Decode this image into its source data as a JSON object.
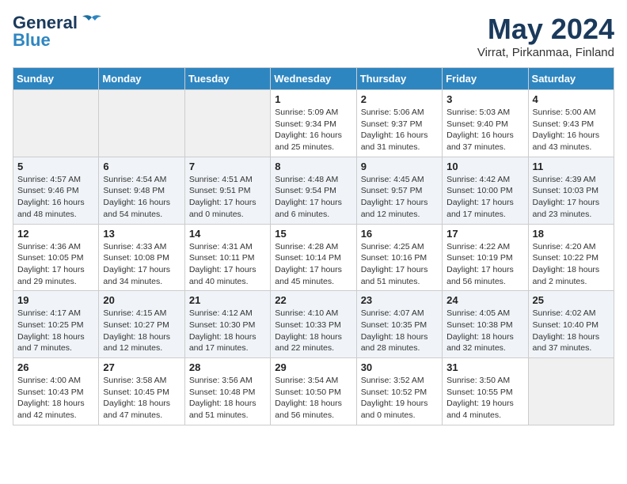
{
  "logo": {
    "line1": "General",
    "line2": "Blue"
  },
  "title": "May 2024",
  "subtitle": "Virrat, Pirkanmaa, Finland",
  "days_of_week": [
    "Sunday",
    "Monday",
    "Tuesday",
    "Wednesday",
    "Thursday",
    "Friday",
    "Saturday"
  ],
  "weeks": [
    [
      {
        "day": "",
        "info": ""
      },
      {
        "day": "",
        "info": ""
      },
      {
        "day": "",
        "info": ""
      },
      {
        "day": "1",
        "info": "Sunrise: 5:09 AM\nSunset: 9:34 PM\nDaylight: 16 hours\nand 25 minutes."
      },
      {
        "day": "2",
        "info": "Sunrise: 5:06 AM\nSunset: 9:37 PM\nDaylight: 16 hours\nand 31 minutes."
      },
      {
        "day": "3",
        "info": "Sunrise: 5:03 AM\nSunset: 9:40 PM\nDaylight: 16 hours\nand 37 minutes."
      },
      {
        "day": "4",
        "info": "Sunrise: 5:00 AM\nSunset: 9:43 PM\nDaylight: 16 hours\nand 43 minutes."
      }
    ],
    [
      {
        "day": "5",
        "info": "Sunrise: 4:57 AM\nSunset: 9:46 PM\nDaylight: 16 hours\nand 48 minutes."
      },
      {
        "day": "6",
        "info": "Sunrise: 4:54 AM\nSunset: 9:48 PM\nDaylight: 16 hours\nand 54 minutes."
      },
      {
        "day": "7",
        "info": "Sunrise: 4:51 AM\nSunset: 9:51 PM\nDaylight: 17 hours\nand 0 minutes."
      },
      {
        "day": "8",
        "info": "Sunrise: 4:48 AM\nSunset: 9:54 PM\nDaylight: 17 hours\nand 6 minutes."
      },
      {
        "day": "9",
        "info": "Sunrise: 4:45 AM\nSunset: 9:57 PM\nDaylight: 17 hours\nand 12 minutes."
      },
      {
        "day": "10",
        "info": "Sunrise: 4:42 AM\nSunset: 10:00 PM\nDaylight: 17 hours\nand 17 minutes."
      },
      {
        "day": "11",
        "info": "Sunrise: 4:39 AM\nSunset: 10:03 PM\nDaylight: 17 hours\nand 23 minutes."
      }
    ],
    [
      {
        "day": "12",
        "info": "Sunrise: 4:36 AM\nSunset: 10:05 PM\nDaylight: 17 hours\nand 29 minutes."
      },
      {
        "day": "13",
        "info": "Sunrise: 4:33 AM\nSunset: 10:08 PM\nDaylight: 17 hours\nand 34 minutes."
      },
      {
        "day": "14",
        "info": "Sunrise: 4:31 AM\nSunset: 10:11 PM\nDaylight: 17 hours\nand 40 minutes."
      },
      {
        "day": "15",
        "info": "Sunrise: 4:28 AM\nSunset: 10:14 PM\nDaylight: 17 hours\nand 45 minutes."
      },
      {
        "day": "16",
        "info": "Sunrise: 4:25 AM\nSunset: 10:16 PM\nDaylight: 17 hours\nand 51 minutes."
      },
      {
        "day": "17",
        "info": "Sunrise: 4:22 AM\nSunset: 10:19 PM\nDaylight: 17 hours\nand 56 minutes."
      },
      {
        "day": "18",
        "info": "Sunrise: 4:20 AM\nSunset: 10:22 PM\nDaylight: 18 hours\nand 2 minutes."
      }
    ],
    [
      {
        "day": "19",
        "info": "Sunrise: 4:17 AM\nSunset: 10:25 PM\nDaylight: 18 hours\nand 7 minutes."
      },
      {
        "day": "20",
        "info": "Sunrise: 4:15 AM\nSunset: 10:27 PM\nDaylight: 18 hours\nand 12 minutes."
      },
      {
        "day": "21",
        "info": "Sunrise: 4:12 AM\nSunset: 10:30 PM\nDaylight: 18 hours\nand 17 minutes."
      },
      {
        "day": "22",
        "info": "Sunrise: 4:10 AM\nSunset: 10:33 PM\nDaylight: 18 hours\nand 22 minutes."
      },
      {
        "day": "23",
        "info": "Sunrise: 4:07 AM\nSunset: 10:35 PM\nDaylight: 18 hours\nand 28 minutes."
      },
      {
        "day": "24",
        "info": "Sunrise: 4:05 AM\nSunset: 10:38 PM\nDaylight: 18 hours\nand 32 minutes."
      },
      {
        "day": "25",
        "info": "Sunrise: 4:02 AM\nSunset: 10:40 PM\nDaylight: 18 hours\nand 37 minutes."
      }
    ],
    [
      {
        "day": "26",
        "info": "Sunrise: 4:00 AM\nSunset: 10:43 PM\nDaylight: 18 hours\nand 42 minutes."
      },
      {
        "day": "27",
        "info": "Sunrise: 3:58 AM\nSunset: 10:45 PM\nDaylight: 18 hours\nand 47 minutes."
      },
      {
        "day": "28",
        "info": "Sunrise: 3:56 AM\nSunset: 10:48 PM\nDaylight: 18 hours\nand 51 minutes."
      },
      {
        "day": "29",
        "info": "Sunrise: 3:54 AM\nSunset: 10:50 PM\nDaylight: 18 hours\nand 56 minutes."
      },
      {
        "day": "30",
        "info": "Sunrise: 3:52 AM\nSunset: 10:52 PM\nDaylight: 19 hours\nand 0 minutes."
      },
      {
        "day": "31",
        "info": "Sunrise: 3:50 AM\nSunset: 10:55 PM\nDaylight: 19 hours\nand 4 minutes."
      },
      {
        "day": "",
        "info": ""
      }
    ]
  ]
}
